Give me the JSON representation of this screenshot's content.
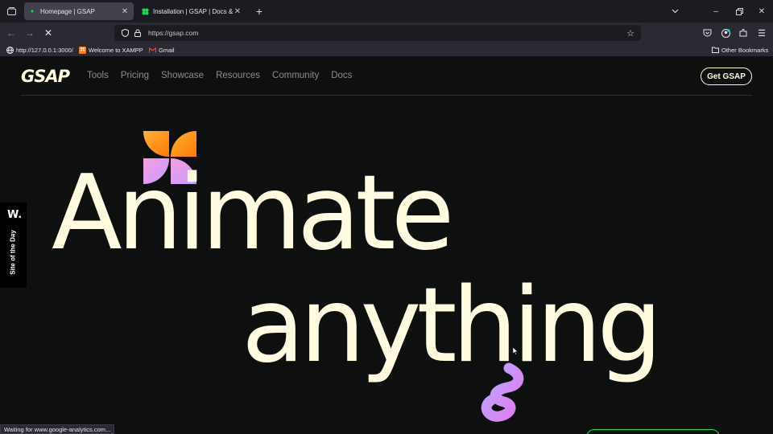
{
  "browser": {
    "tabs": [
      {
        "title": "Homepage | GSAP",
        "active": true
      },
      {
        "title": "Installation | GSAP | Docs & Lea",
        "active": false
      }
    ],
    "url": "https://gsap.com",
    "bookmarks": [
      {
        "label": "http://127.0.0.1:3000/",
        "icon": "globe-icon"
      },
      {
        "label": "Welcome to XAMPP",
        "icon": "xampp-icon"
      },
      {
        "label": "Gmail",
        "icon": "gmail-icon"
      }
    ],
    "other_bookmarks": "Other Bookmarks",
    "status_text": "Waiting for www.google-analytics.com..."
  },
  "site": {
    "logo": "GSAP",
    "nav": [
      "Tools",
      "Pricing",
      "Showcase",
      "Resources",
      "Community",
      "Docs"
    ],
    "cta": "Get GSAP",
    "badge": {
      "logo": "W.",
      "label": "Site of the Day"
    },
    "headline": {
      "line1": "Animate",
      "line2": "anything"
    }
  },
  "colors": {
    "background": "#0e100f",
    "text": "#fffce1",
    "nav_text": "#8f8e86",
    "accent_green": "#0ae448",
    "accent_orange": "#ff8709",
    "accent_purple": "#9d95ff"
  }
}
